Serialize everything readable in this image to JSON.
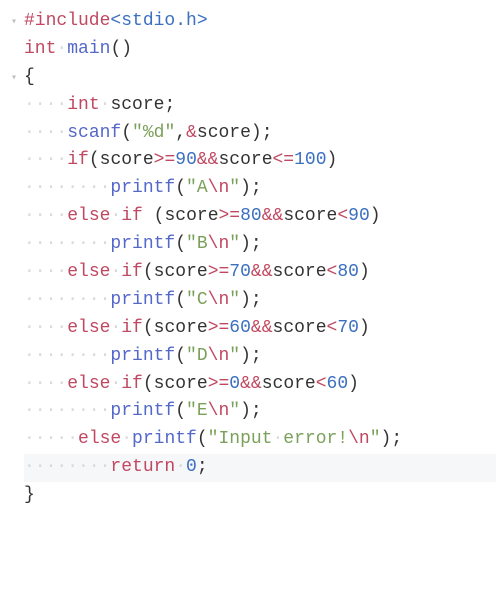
{
  "chart_data": {
    "type": "table",
    "title": "C source code (grade from score)",
    "lines": [
      "#include<stdio.h>",
      "int main()",
      "{",
      "    int score;",
      "    scanf(\"%d\",&score);",
      "    if(score>=90&&score<=100)",
      "        printf(\"A\\n\");",
      "    else if (score>=80&&score<90)",
      "        printf(\"B\\n\");",
      "    else if(score>=70&&score<80)",
      "        printf(\"C\\n\");",
      "    else if(score>=60&&score<70)",
      "        printf(\"D\\n\");",
      "    else if(score>=0&&score<60)",
      "        printf(\"E\\n\");",
      "     else printf(\"Input error!\\n\");",
      "        return 0;",
      "}"
    ]
  },
  "gutter": {
    "fold": "▾"
  },
  "tok": {
    "hash_include": "#include",
    "stdio": "<stdio.h>",
    "int": "int",
    "main": "main",
    "lparen": "(",
    "rparen": ")",
    "lbrace": "{",
    "rbrace": "}",
    "score": "score",
    "semi": ";",
    "scanf": "scanf",
    "q_pd": "\"%d\"",
    "comma": ",",
    "amp": "&",
    "if": "if",
    "else": "else",
    "ge": ">=",
    "le": "<=",
    "lt": "<",
    "andand": "&&",
    "n90": "90",
    "n100": "100",
    "n80": "80",
    "n70": "70",
    "n60": "60",
    "n0": "0",
    "printf": "printf",
    "qA1": "\"A",
    "qB1": "\"B",
    "qC1": "\"C",
    "qD1": "\"D",
    "qE1": "\"E",
    "qErr1": "\"Input",
    "err_rest": "error!",
    "esc_n": "\\n",
    "q2": "\"",
    "return": "return",
    "sp": "·"
  },
  "ws": {
    "d4": "····",
    "d5": "·····",
    "d8": "········",
    "sp": "·"
  }
}
